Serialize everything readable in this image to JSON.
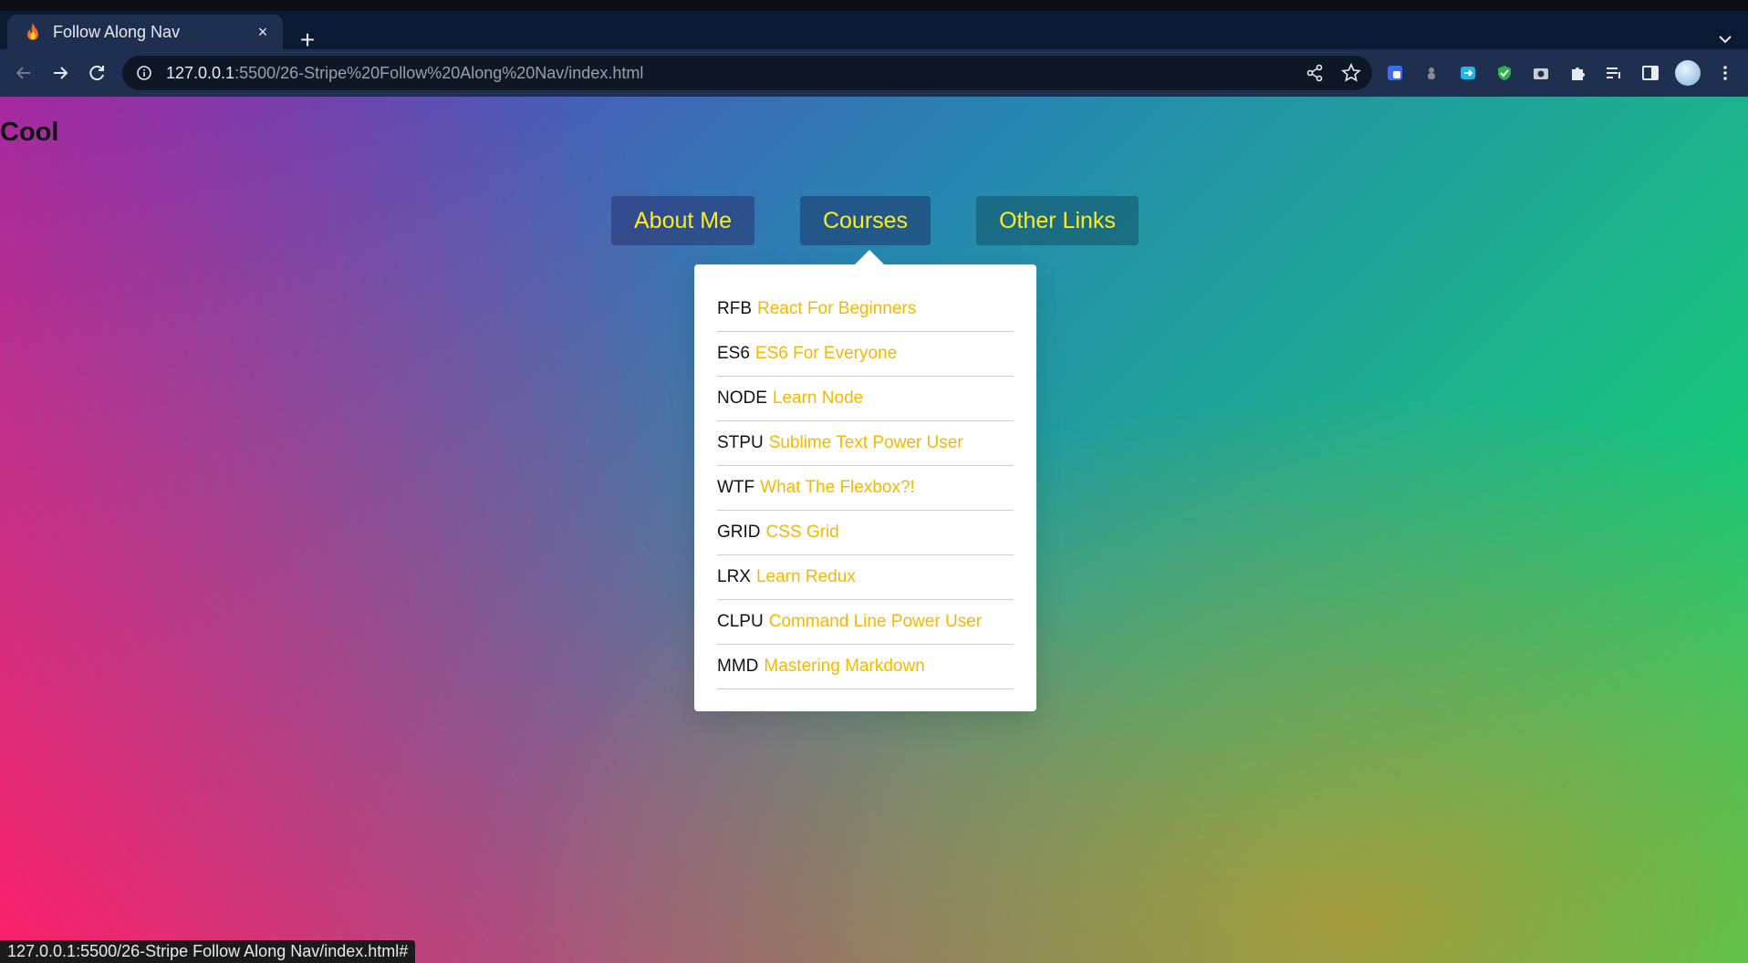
{
  "browser": {
    "tab_title": "Follow Along Nav",
    "new_tab_symbol": "+",
    "close_symbol": "×",
    "url_host": "127.0.0.1",
    "url_rest": ":5500/26-Stripe%20Follow%20Along%20Nav/index.html",
    "status_url": "127.0.0.1:5500/26-Stripe Follow Along Nav/index.html#",
    "icons": [
      "back-arrow-icon",
      "forward-arrow-icon",
      "reload-icon",
      "info-icon",
      "share-icon",
      "star-icon",
      "extension-icons",
      "puzzle-icon",
      "tab-search-icon",
      "side-panel-icon",
      "profile-avatar"
    ]
  },
  "page": {
    "title": "Cool",
    "nav": {
      "about": "About Me",
      "courses": "Courses",
      "other": "Other Links"
    },
    "courses": [
      {
        "code": "RFB",
        "name": "React For Beginners"
      },
      {
        "code": "ES6",
        "name": "ES6 For Everyone"
      },
      {
        "code": "NODE",
        "name": "Learn Node"
      },
      {
        "code": "STPU",
        "name": "Sublime Text Power User"
      },
      {
        "code": "WTF",
        "name": "What The Flexbox?!"
      },
      {
        "code": "GRID",
        "name": "CSS Grid"
      },
      {
        "code": "LRX",
        "name": "Learn Redux"
      },
      {
        "code": "CLPU",
        "name": "Command Line Power User"
      },
      {
        "code": "MMD",
        "name": "Mastering Markdown"
      }
    ]
  },
  "colors": {
    "nav_text": "#ffec1f",
    "course_link": "#f5b800",
    "browser_frame": "#1e2f50"
  }
}
